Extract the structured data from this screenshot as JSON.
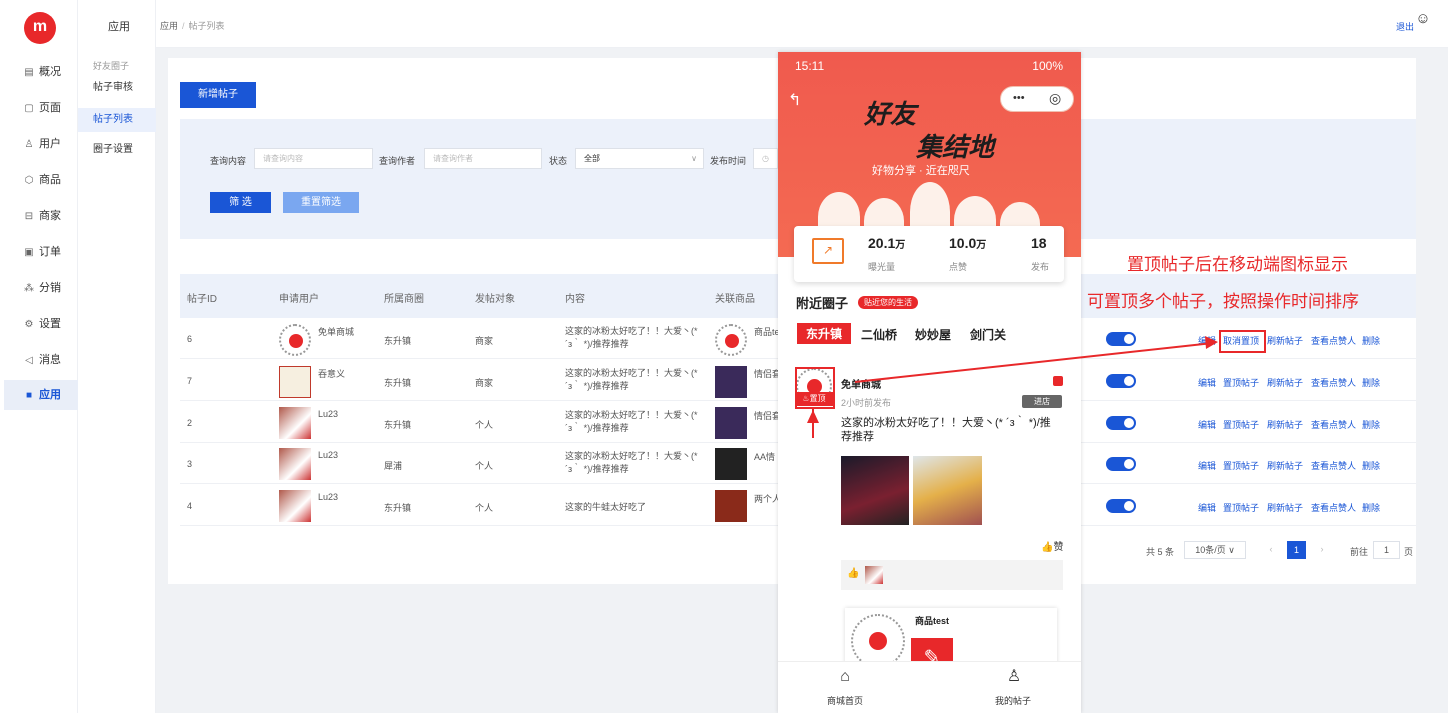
{
  "sidebar": {
    "logo": "m",
    "items": [
      {
        "icon": "▤",
        "label": "概况"
      },
      {
        "icon": "▢",
        "label": "页面"
      },
      {
        "icon": "♙",
        "label": "用户"
      },
      {
        "icon": "⬡",
        "label": "商品"
      },
      {
        "icon": "⊟",
        "label": "商家"
      },
      {
        "icon": "▣",
        "label": "订单"
      },
      {
        "icon": "⁂",
        "label": "分销"
      },
      {
        "icon": "⚙",
        "label": "设置"
      },
      {
        "icon": "◁",
        "label": "消息"
      },
      {
        "icon": "■",
        "label": "应用"
      }
    ]
  },
  "submenu": {
    "title": "应用",
    "group": "好友圈子",
    "items": [
      "帖子审核",
      "帖子列表",
      "圈子设置"
    ]
  },
  "header": {
    "breadcrumb_root": "应用",
    "breadcrumb_sep": "/",
    "breadcrumb_current": "帖子列表",
    "logout": "退出",
    "smile_icon": "☺",
    "layout_icon": "⊟"
  },
  "toolbar": {
    "add_label": "新增帖子"
  },
  "filters": {
    "query_content_label": "查询内容",
    "query_content_placeholder": "请查询内容",
    "query_author_label": "查询作者",
    "query_author_placeholder": "请查询作者",
    "status_label": "状态",
    "status_value": "全部",
    "publish_time_label": "发布时间",
    "filter_button": "筛 选",
    "reset_button": "重置筛选"
  },
  "table": {
    "headers": [
      "帖子ID",
      "申请用户",
      "所属商圈",
      "发帖对象",
      "内容",
      "关联商品"
    ],
    "rows": [
      {
        "id": "6",
        "user": "免单商城",
        "area": "东升镇",
        "target": "商家",
        "content": "这家的冰粉太好吃了！！大爱丶(* ´з｀ *)/推荐推荐",
        "product": "商品te",
        "action2": "取消置顶"
      },
      {
        "id": "7",
        "user": "吞意义",
        "area": "东升镇",
        "target": "商家",
        "content": "这家的冰粉太好吃了！！大爱丶(* ´з｀ *)/推荐推荐",
        "product": "情侣套",
        "action2": "置顶帖子"
      },
      {
        "id": "2",
        "user": "Lu23",
        "area": "东升镇",
        "target": "个人",
        "content": "这家的冰粉太好吃了！！大爱丶(* ´з｀ *)/推荐推荐",
        "product": "情侣套",
        "action2": "置顶帖子"
      },
      {
        "id": "3",
        "user": "Lu23",
        "area": "犀浦",
        "target": "个人",
        "content": "这家的冰粉太好吃了！！大爱丶(* ´з｀ *)/推荐推荐",
        "product": "AA情",
        "action2": "置顶帖子"
      },
      {
        "id": "4",
        "user": "Lu23",
        "area": "东升镇",
        "target": "个人",
        "content": "这家的牛蛙太好吃了",
        "product": "两个人",
        "action2": "置顶帖子"
      }
    ],
    "action_edit": "编辑",
    "action_refresh": "刷新帖子",
    "action_likes": "查看点赞人",
    "action_delete": "删除"
  },
  "pager": {
    "total": "共 5 条",
    "page_size": "10条/页",
    "current": "1",
    "goto_label": "前往",
    "goto_value": "1",
    "page_unit": "页"
  },
  "phone": {
    "time": "15:11",
    "status_right": "100%",
    "title1": "好友",
    "title2": "集结地",
    "slogan": "好物分享 · 近在咫尺",
    "stats": [
      {
        "value": "20.1",
        "unit": "万",
        "label": "曝光量"
      },
      {
        "value": "10.0",
        "unit": "万",
        "label": "点赞"
      },
      {
        "value": "18",
        "unit": "",
        "label": "发布"
      }
    ],
    "circle_title": "附近圈子",
    "circle_tag": "贴近您的生活",
    "tabs": [
      "东升镇",
      "二仙桥",
      "妙妙屋",
      "剑门关"
    ],
    "post_user": "免单商城",
    "post_time": "2小时前发布",
    "pin_badge": "置顶",
    "visit_button": "进店",
    "post_text": "这家的冰粉太好吃了！！大爱丶(* ´з｀ *)/推荐推荐",
    "like_label": "赞",
    "product_name": "商品test",
    "tabbar": [
      "商城首页",
      "我的帖子"
    ]
  },
  "annotations": {
    "line1": "置顶帖子后在移动端图标显示",
    "line2": "可置顶多个帖子，按照操作时间排序"
  },
  "colors": {
    "primary": "#1a56d6",
    "brand_red": "#e8282a"
  }
}
